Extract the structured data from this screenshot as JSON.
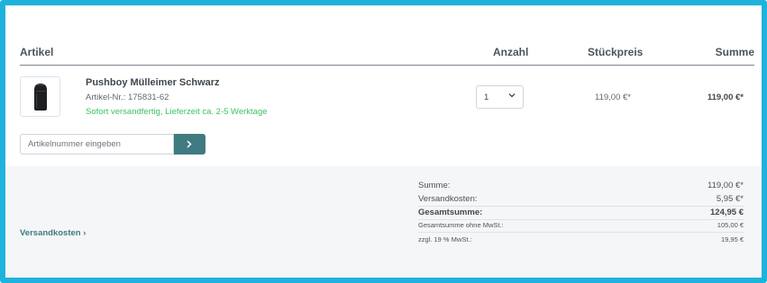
{
  "table_header": {
    "article": "Artikel",
    "quantity": "Anzahl",
    "unit_price": "Stückpreis",
    "total": "Summe"
  },
  "item": {
    "name": "Pushboy Mülleimer Schwarz",
    "sku": "Artikel-Nr.: 175831-62",
    "delivery": "Sofort versandfertig, Lieferzeit ca. 2-5 Werktage",
    "quantity": "1",
    "unit_price": "119,00 €*",
    "row_total": "119,00 €*",
    "image_icon": "trash-bin-product-image"
  },
  "add_article": {
    "placeholder": "Artikelnummer eingeben",
    "button_icon": "chevron-right-icon"
  },
  "summary": {
    "shipping_link": "Versandkosten",
    "shipping_link_icon": "›",
    "rows": [
      {
        "label": "Summe:",
        "value": "119,00 €*"
      },
      {
        "label": "Versandkosten:",
        "value": "5,95 €*"
      },
      {
        "label": "Gesamtsumme:",
        "value": "124,95 €"
      },
      {
        "label": "Gesamtsumme ohne MwSt.:",
        "value": "105,00 €"
      },
      {
        "label": "zzgl. 19 % MwSt.:",
        "value": "19,95 €"
      }
    ]
  },
  "colors": {
    "frame_border": "#1fb3dc",
    "accent": "#3f7b80",
    "delivery_green": "#3cc261",
    "footer_bg": "#f5f6f8"
  }
}
